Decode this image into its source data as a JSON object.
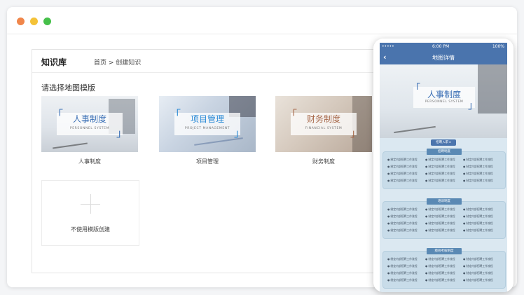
{
  "window": {
    "controls": [
      "close",
      "minimize",
      "maximize"
    ]
  },
  "panel": {
    "title": "知识库",
    "breadcrumb": "首页 > 创建知识",
    "choose_label": "请选择地图模版",
    "templates": [
      {
        "name": "人事制度",
        "image_title": "人事制度",
        "image_subtitle": "PERSONNEL SYSTEM",
        "accent": "#3a6fb5"
      },
      {
        "name": "项目管理",
        "image_title": "项目管理",
        "image_subtitle": "PROJECT MANAGEMENT",
        "accent": "#2a8ad6"
      },
      {
        "name": "财务制度",
        "image_title": "财务制度",
        "image_subtitle": "FINANCIAL SYSTEM",
        "accent": "#a7684a"
      }
    ],
    "blank_template": {
      "label": "不使用模版创建",
      "icon": "plus-icon"
    }
  },
  "phone": {
    "status": {
      "signal": "••••• ",
      "time": "6:00 PM",
      "battery": "100%"
    },
    "nav": {
      "back_icon": "chevron-left-icon",
      "title": "地图详情"
    },
    "hero": {
      "title": "人事制度",
      "subtitle": "PERSONNEL SYSTEM"
    },
    "hero_button": "招聘入职 ▸",
    "sections": [
      {
        "badge": "招聘制度",
        "items": [
          "● 制定内部招聘工作流程",
          "● 制定内部招聘工作流程",
          "● 制定内部招聘工作流程",
          "● 制定内部招聘工作流程",
          "● 制定内部招聘工作流程",
          "● 制定内部招聘工作流程",
          "● 制定内部招聘工作流程",
          "● 制定内部招聘工作流程",
          "● 制定内部招聘工作流程",
          "● 制定内部招聘工作流程",
          "● 制定内部招聘工作流程",
          "● 制定内部招聘工作流程"
        ]
      },
      {
        "badge": "培训制度",
        "items": [
          "● 制定内部招聘工作流程",
          "● 制定内部招聘工作流程",
          "● 制定内部招聘工作流程",
          "● 制定内部招聘工作流程",
          "● 制定内部招聘工作流程",
          "● 制定内部招聘工作流程",
          "● 制定内部招聘工作流程",
          "● 制定内部招聘工作流程",
          "● 制定内部招聘工作流程",
          "● 制定内部招聘工作流程",
          "● 制定内部招聘工作流程",
          "● 制定内部招聘工作流程"
        ]
      },
      {
        "badge": "绩效考核制度",
        "items": [
          "● 制定内部招聘工作流程",
          "● 制定内部招聘工作流程",
          "● 制定内部招聘工作流程",
          "● 制定内部招聘工作流程",
          "● 制定内部招聘工作流程",
          "● 制定内部招聘工作流程",
          "● 制定内部招聘工作流程",
          "● 制定内部招聘工作流程",
          "● 制定内部招聘工作流程",
          "● 制定内部招聘工作流程",
          "● 制定内部招聘工作流程",
          "● 制定内部招聘工作流程"
        ]
      }
    ]
  }
}
